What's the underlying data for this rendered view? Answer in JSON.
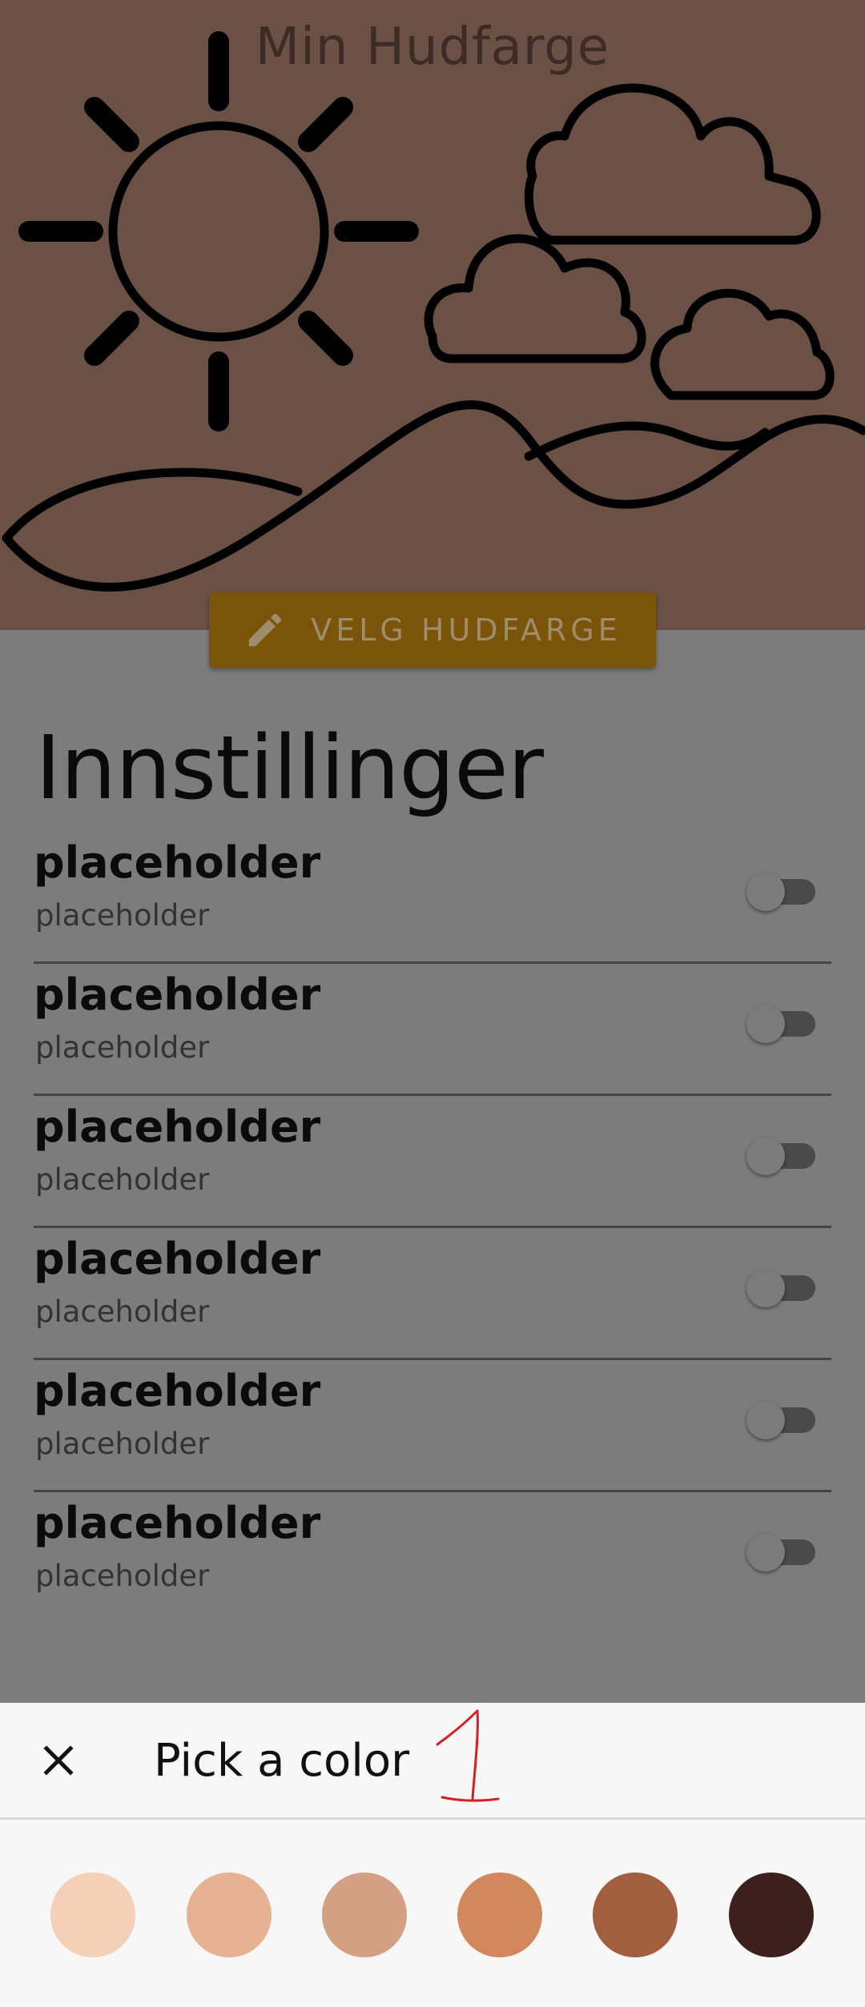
{
  "header": {
    "title": "Min Hudfarge"
  },
  "hero": {
    "background_color": "#6b5046",
    "illustration": "sun-clouds-hills"
  },
  "action_button": {
    "label": "VELG HUDFARGE",
    "icon": "pencil-icon",
    "color": "#7a5409"
  },
  "settings": {
    "title": "Innstillinger",
    "items": [
      {
        "title": "placeholder",
        "subtitle": "placeholder",
        "enabled": false
      },
      {
        "title": "placeholder",
        "subtitle": "placeholder",
        "enabled": false
      },
      {
        "title": "placeholder",
        "subtitle": "placeholder",
        "enabled": false
      },
      {
        "title": "placeholder",
        "subtitle": "placeholder",
        "enabled": false
      },
      {
        "title": "placeholder",
        "subtitle": "placeholder",
        "enabled": false
      },
      {
        "title": "placeholder",
        "subtitle": "placeholder",
        "enabled": false
      }
    ]
  },
  "color_picker": {
    "title": "Pick a color",
    "close_icon": "close-icon",
    "annotation": "1",
    "swatches": [
      "#f3d0b6",
      "#e6b293",
      "#d3a084",
      "#d2875d",
      "#a25f3f",
      "#3c201d"
    ]
  }
}
